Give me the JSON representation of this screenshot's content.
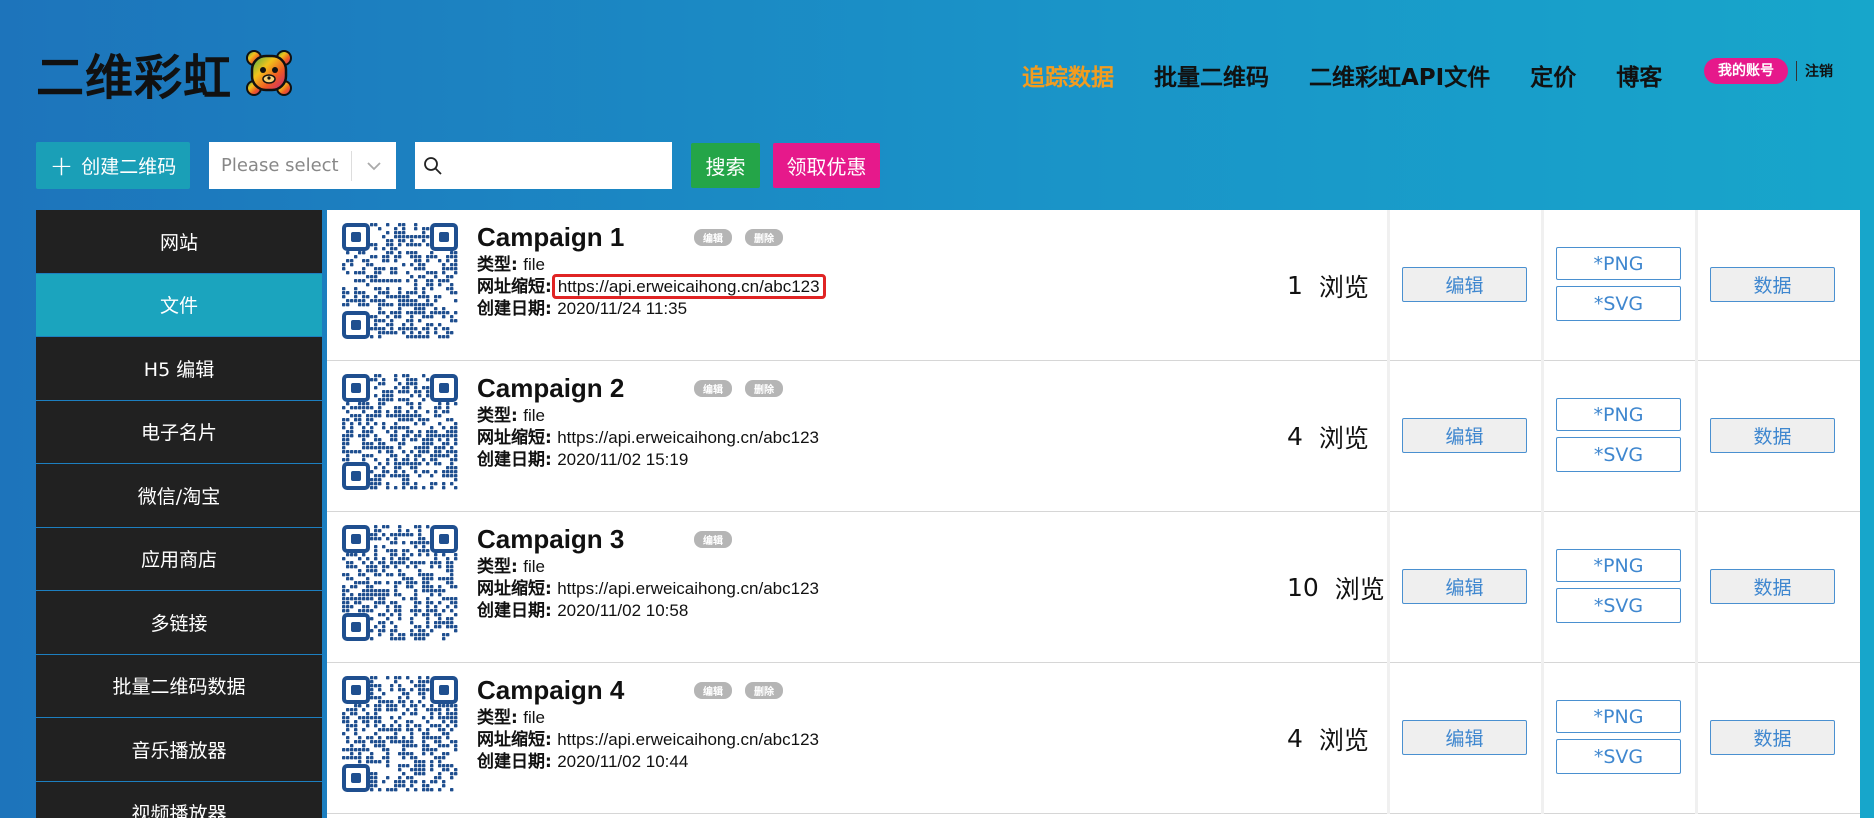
{
  "header": {
    "logo_text": "二维彩虹",
    "nav": [
      {
        "label": "追踪数据",
        "active": true
      },
      {
        "label": "批量二维码",
        "active": false
      },
      {
        "label": "二维彩虹API文件",
        "active": false
      },
      {
        "label": "定价",
        "active": false
      },
      {
        "label": "博客",
        "active": false
      }
    ],
    "account_label": "我的账号",
    "logout_label": "注销"
  },
  "toolbar": {
    "create_label": "创建二维码",
    "select_placeholder": "Please select",
    "search_placeholder": "",
    "search_label": "搜索",
    "promo_label": "领取优惠"
  },
  "sidebar": {
    "items": [
      {
        "label": "网站",
        "active": false
      },
      {
        "label": "文件",
        "active": true
      },
      {
        "label": "H5 编辑",
        "active": false
      },
      {
        "label": "电子名片",
        "active": false
      },
      {
        "label": "微信/淘宝",
        "active": false
      },
      {
        "label": "应用商店",
        "active": false
      },
      {
        "label": "多链接",
        "active": false
      },
      {
        "label": "批量二维码数据",
        "active": false
      },
      {
        "label": "音乐播放器",
        "active": false
      },
      {
        "label": "视频播放器",
        "active": false
      }
    ]
  },
  "labels": {
    "type": "类型:",
    "short_url": "网址缩短:",
    "created": "创建日期:",
    "views_suffix": "浏览",
    "edit_tag": "编辑",
    "delete_tag": "删除",
    "edit_button": "编辑",
    "png_button": "*PNG",
    "svg_button": "*SVG",
    "data_button": "数据"
  },
  "campaigns": [
    {
      "title": "Campaign 1",
      "type": "file",
      "url": "https://api.erweicaihong.cn/abc123",
      "created": "2020/11/24  11:35",
      "views": "1",
      "has_delete": true,
      "highlight_url": true
    },
    {
      "title": "Campaign 2",
      "type": "file",
      "url": "https://api.erweicaihong.cn/abc123",
      "created": "2020/11/02  15:19",
      "views": "4",
      "has_delete": true,
      "highlight_url": false
    },
    {
      "title": "Campaign 3",
      "type": "file",
      "url": "https://api.erweicaihong.cn/abc123",
      "created": "2020/11/02  10:58",
      "views": "10",
      "has_delete": false,
      "highlight_url": false
    },
    {
      "title": "Campaign 4",
      "type": "file",
      "url": "https://api.erweicaihong.cn/abc123",
      "created": "2020/11/02  10:44",
      "views": "4",
      "has_delete": true,
      "highlight_url": false
    }
  ],
  "colors": {
    "accent_orange": "#f39c1f",
    "accent_pink": "#e6198b",
    "accent_teal": "#1ba4be",
    "search_green": "#24a548",
    "highlight_red": "#e02424"
  },
  "icons": {
    "logo": "rainbow-bear-icon",
    "create": "plus-icon",
    "select": "chevron-down-icon",
    "search": "search-icon",
    "qr": "qr-code-icon"
  }
}
